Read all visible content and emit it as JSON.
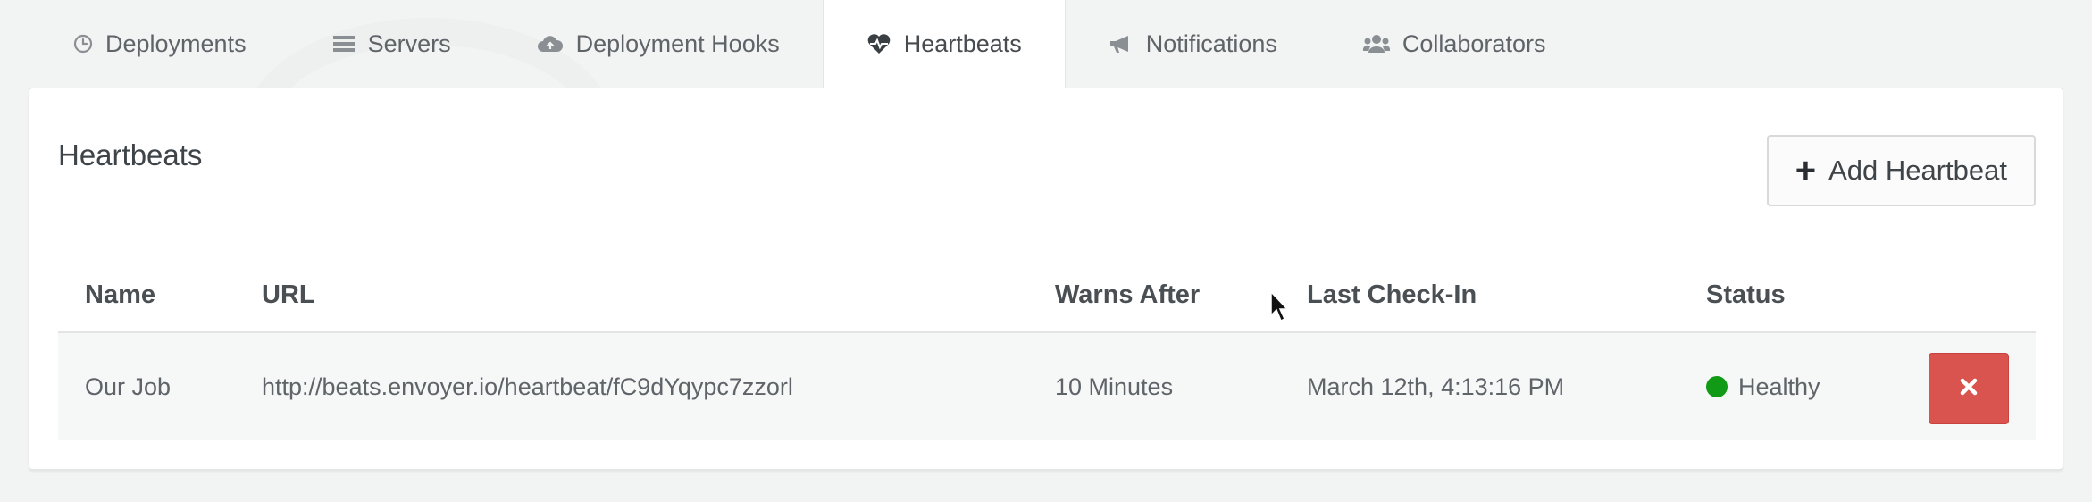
{
  "tabs": [
    {
      "label": "Deployments",
      "icon": "clock-icon",
      "active": false
    },
    {
      "label": "Servers",
      "icon": "server-list-icon",
      "active": false
    },
    {
      "label": "Deployment Hooks",
      "icon": "cloud-upload-icon",
      "active": false
    },
    {
      "label": "Heartbeats",
      "icon": "heartbeat-icon",
      "active": true
    },
    {
      "label": "Notifications",
      "icon": "megaphone-icon",
      "active": false
    },
    {
      "label": "Collaborators",
      "icon": "users-icon",
      "active": false
    }
  ],
  "panel": {
    "title": "Heartbeats",
    "add_button_label": "Add Heartbeat"
  },
  "table": {
    "headers": [
      "Name",
      "URL",
      "Warns After",
      "Last Check-In",
      "Status"
    ],
    "rows": [
      {
        "name": "Our Job",
        "url": "http://beats.envoyer.io/heartbeat/fC9dYqypc7zzorl",
        "warns_after": "10 Minutes",
        "last_check_in": "March 12th, 4:13:16 PM",
        "status": "Healthy",
        "status_color": "#119a16"
      }
    ]
  },
  "colors": {
    "danger": "#d9534f",
    "background": "#f2f3f3",
    "panel": "#ffffff"
  }
}
